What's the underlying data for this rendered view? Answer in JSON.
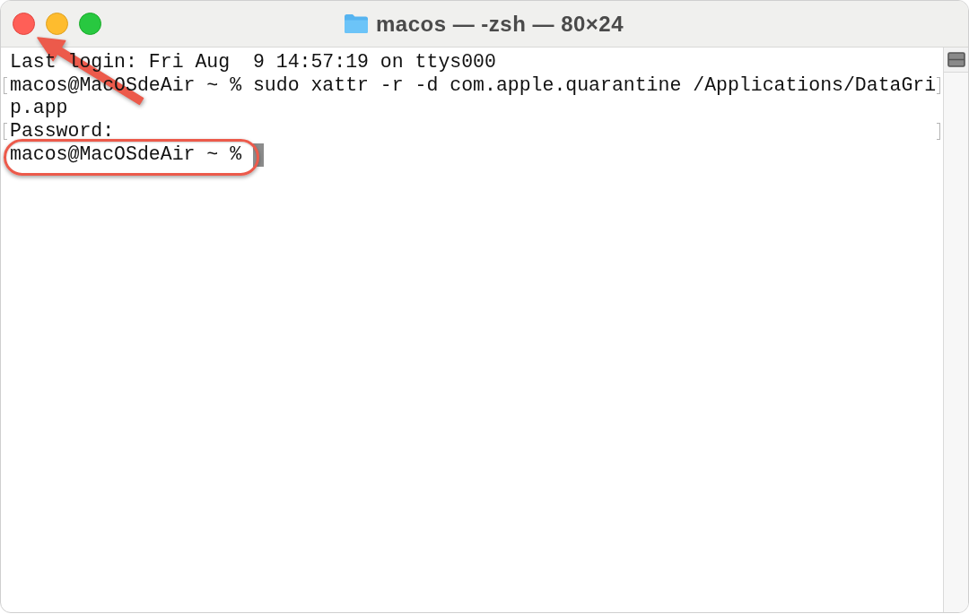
{
  "window": {
    "title": "macos — -zsh — 80×24",
    "buttons": [
      {
        "kind": "close"
      },
      {
        "kind": "minimize"
      },
      {
        "kind": "zoom"
      }
    ]
  },
  "terminal": {
    "lines": [
      {
        "text": "Last login: Fri Aug  9 14:57:19 on ttys000",
        "marked": false,
        "highlighted": false,
        "cursor": false
      },
      {
        "text": "macos@MacOSdeAir ~ % sudo xattr -r -d com.apple.quarantine /Applications/DataGri",
        "marked": true,
        "highlighted": false,
        "cursor": false
      },
      {
        "text": "p.app",
        "marked": false,
        "highlighted": false,
        "cursor": false
      },
      {
        "text": "Password:",
        "marked": true,
        "highlighted": false,
        "cursor": false
      },
      {
        "text": "macos@MacOSdeAir ~ %",
        "marked": false,
        "highlighted": true,
        "cursor": true
      }
    ]
  },
  "annotations": [
    {
      "kind": "arrow"
    }
  ]
}
